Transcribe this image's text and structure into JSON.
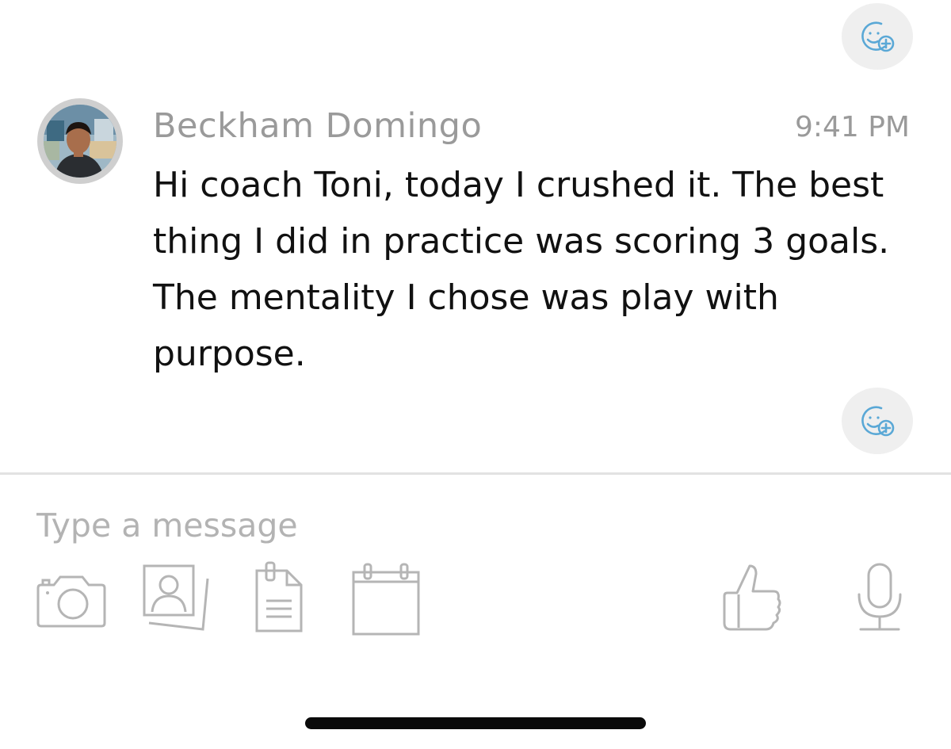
{
  "message": {
    "sender_name": "Beckham Domingo",
    "timestamp": "9:41 PM",
    "text": "Hi coach Toni, today I crushed it. The best thing I did in practice was scoring 3 goals. The mentality I chose was play with purpose."
  },
  "reactions": {
    "icon": "add-reaction-icon"
  },
  "composer": {
    "placeholder": "Type a message",
    "value": ""
  },
  "toolbar": {
    "left": [
      "camera-icon",
      "contacts-icon",
      "form-icon",
      "calendar-icon"
    ],
    "right": [
      "thumbs-up-icon",
      "microphone-icon"
    ]
  },
  "colors": {
    "icon_gray": "#b5b5b5",
    "reaction_blue": "#5aa8d6",
    "secondary_text": "#9a9a9a",
    "divider": "#e2e2e2"
  }
}
